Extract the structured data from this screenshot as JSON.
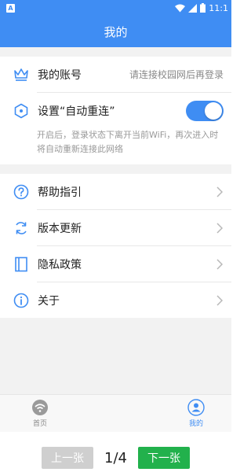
{
  "status_bar": {
    "time": "11:1",
    "badge": "A"
  },
  "header": {
    "title": "我的"
  },
  "account": {
    "label": "我的账号",
    "hint": "请连接校园网后再登录"
  },
  "auto_reconnect": {
    "label": "设置“自动重连”",
    "enabled": true,
    "description": "开启后，登录状态下离开当前WiFi，再次进入时将自动重新连接此网络"
  },
  "menu": {
    "items": [
      {
        "label": "帮助指引",
        "icon": "help-circle-icon"
      },
      {
        "label": "版本更新",
        "icon": "refresh-icon"
      },
      {
        "label": "隐私政策",
        "icon": "book-icon"
      },
      {
        "label": "关于",
        "icon": "info-icon"
      }
    ]
  },
  "tabbar": {
    "items": [
      {
        "label": "首页",
        "icon": "wifi-icon",
        "active": false
      },
      {
        "label": "我的",
        "icon": "user-icon",
        "active": true
      }
    ]
  },
  "pager": {
    "prev_label": "上一张",
    "next_label": "下一张",
    "page": "1/4"
  },
  "colors": {
    "accent": "#3f8df3",
    "next_button": "#22b14c",
    "prev_button": "#cfcfcf"
  }
}
